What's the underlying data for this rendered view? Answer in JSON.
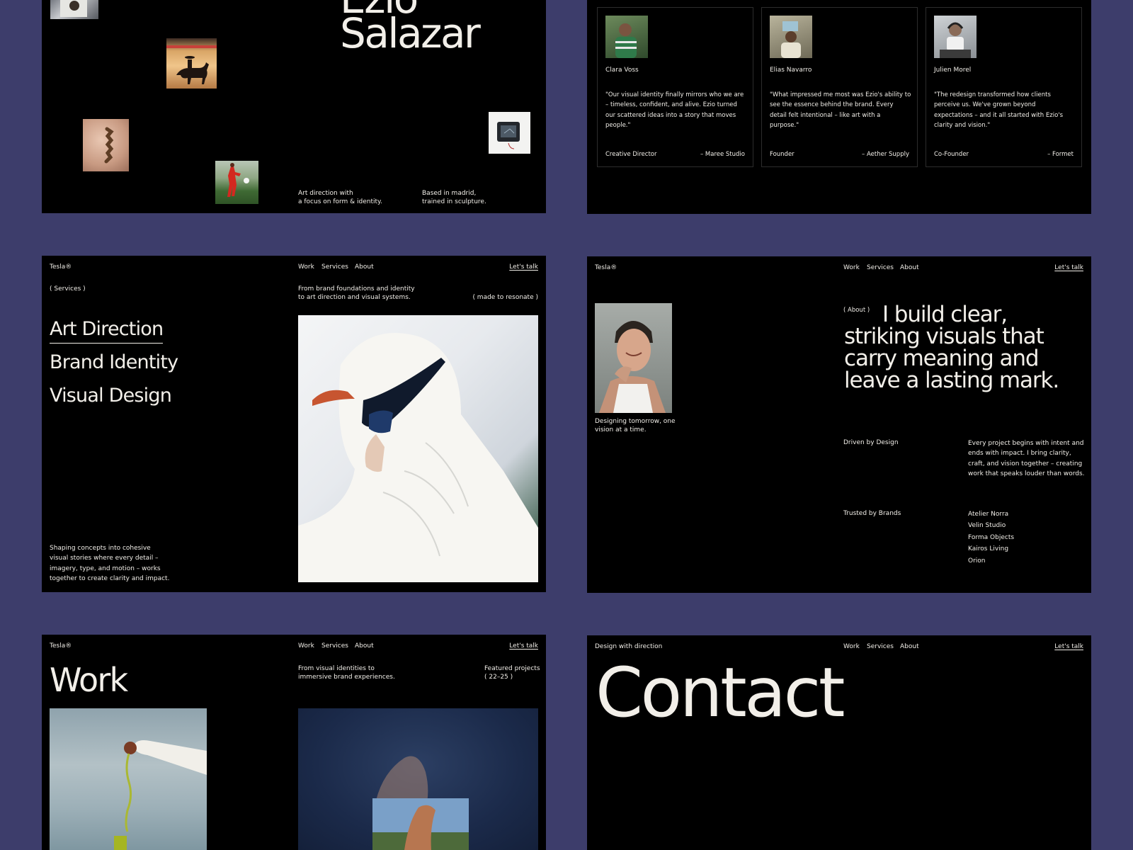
{
  "colors": {
    "background": "#3d3d6b",
    "panel": "#000000",
    "text": "#f2efe9",
    "card_border": "#2c2c2c"
  },
  "nav": {
    "brand": "Tesla®",
    "brand_alt": "Design with direction",
    "items": [
      "Work",
      "Services",
      "About"
    ],
    "cta": "Let's talk"
  },
  "hero": {
    "name_first": "Ezio",
    "name_last": "Salazar",
    "tagline_1": "Art direction with",
    "tagline_2": "a focus on form & identity.",
    "location_1": "Based in madrid,",
    "location_2": "trained in sculpture."
  },
  "testimonials": [
    {
      "name": "Clara Voss",
      "quote": "\"Our visual identity finally mirrors who we are – timeless, confident, and alive. Ezio turned our scattered ideas into a story that moves people.\"",
      "role": "Creative Director",
      "company": "– Maree Studio"
    },
    {
      "name": "Elias Navarro",
      "quote": "\"What impressed me most was Ezio's ability to see the essence behind the brand. Every detail felt intentional – like art with a purpose.\"",
      "role": "Founder",
      "company": "– Aether Supply"
    },
    {
      "name": "Julien Morel",
      "quote": "\"The redesign transformed how clients perceive us. We've grown beyond expectations – and it all started with Ezio's clarity and vision.\"",
      "role": "Co-Founder",
      "company": "– Formet"
    }
  ],
  "services": {
    "label": "( Services )",
    "intro_1": "From brand foundations and identity",
    "intro_2": "to art direction and visual systems.",
    "tag": "( made to resonate )",
    "items": [
      "Art Direction",
      "Brand Identity",
      "Visual Design"
    ],
    "description": "Shaping concepts into cohesive visual stories where every detail – imagery, type, and motion – works together to create clarity and impact."
  },
  "about": {
    "label": "( About )",
    "heading": "I build clear, striking visuals that carry meaning and leave a lasting mark.",
    "caption_1": "Designing tomorrow, one",
    "caption_2": "vision at a time.",
    "driven_label": "Driven by Design",
    "driven_text": "Every project begins with intent and ends with impact. I bring clarity, craft, and vision together – creating work that speaks louder than words.",
    "brands_label": "Trusted by Brands",
    "brands": [
      "Atelier Norra",
      "Velin Studio",
      "Forma Objects",
      "Kairos Living",
      "Orion"
    ]
  },
  "work": {
    "title": "Work",
    "intro_1": "From visual identities to",
    "intro_2": "immersive brand experiences.",
    "featured_1": "Featured projects",
    "featured_2": "( 22–25 )"
  },
  "contact": {
    "title": "Contact"
  }
}
